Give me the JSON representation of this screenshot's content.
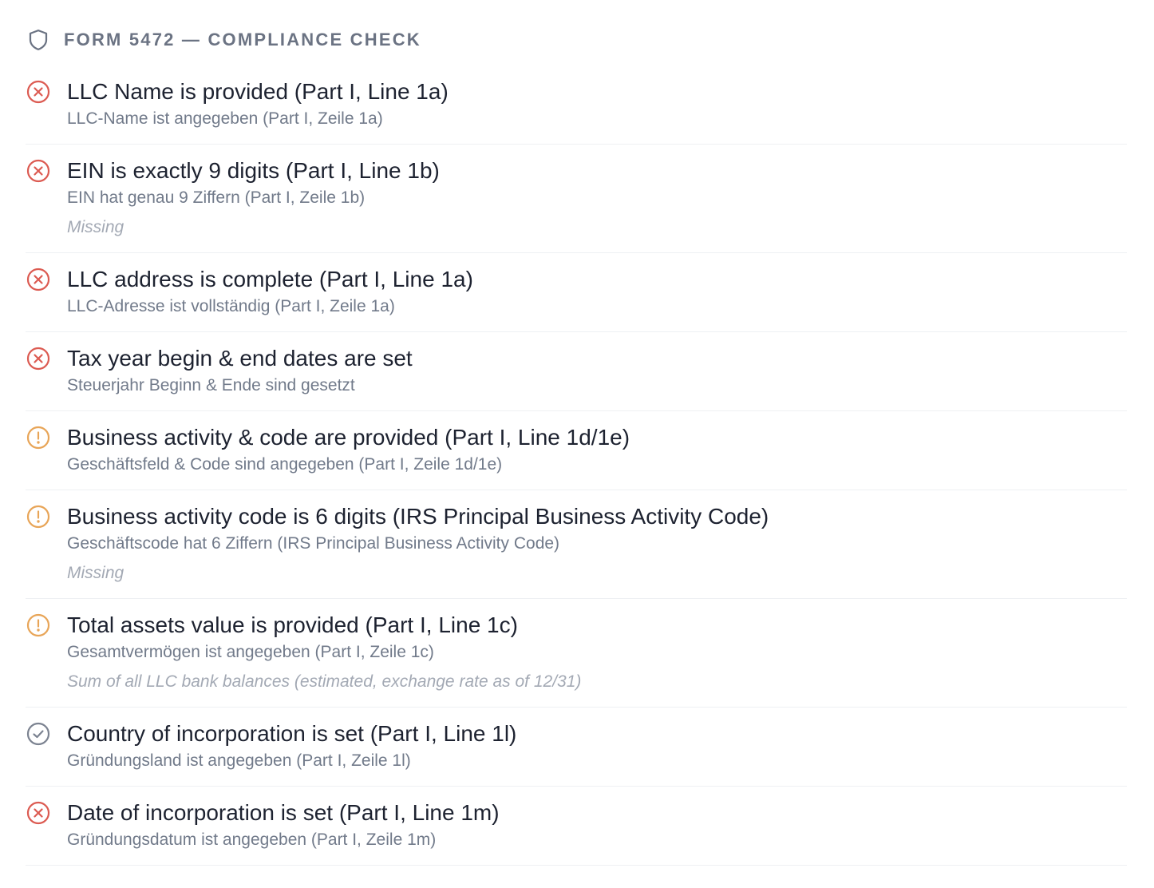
{
  "header": {
    "title": "FORM 5472 — COMPLIANCE CHECK",
    "icon": "shield-icon"
  },
  "colors": {
    "error": "#dc5b52",
    "warning": "#e8a558",
    "ok": "#7c8391"
  },
  "checks": [
    {
      "status": "error",
      "icon": "error-circle-icon",
      "title": "LLC Name is provided (Part I, Line 1a)",
      "subtitle": "LLC-Name ist angegeben (Part I, Zeile 1a)",
      "note": ""
    },
    {
      "status": "error",
      "icon": "error-circle-icon",
      "title": "EIN is exactly 9 digits (Part I, Line 1b)",
      "subtitle": "EIN hat genau 9 Ziffern (Part I, Zeile 1b)",
      "note": "Missing"
    },
    {
      "status": "error",
      "icon": "error-circle-icon",
      "title": "LLC address is complete (Part I, Line 1a)",
      "subtitle": "LLC-Adresse ist vollständig (Part I, Zeile 1a)",
      "note": ""
    },
    {
      "status": "error",
      "icon": "error-circle-icon",
      "title": "Tax year begin & end dates are set",
      "subtitle": "Steuerjahr Beginn & Ende sind gesetzt",
      "note": ""
    },
    {
      "status": "warning",
      "icon": "warning-circle-icon",
      "title": "Business activity & code are provided (Part I, Line 1d/1e)",
      "subtitle": "Geschäftsfeld & Code sind angegeben (Part I, Zeile 1d/1e)",
      "note": ""
    },
    {
      "status": "warning",
      "icon": "warning-circle-icon",
      "title": "Business activity code is 6 digits (IRS Principal Business Activity Code)",
      "subtitle": "Geschäftscode hat 6 Ziffern (IRS Principal Business Activity Code)",
      "note": "Missing"
    },
    {
      "status": "warning",
      "icon": "warning-circle-icon",
      "title": "Total assets value is provided (Part I, Line 1c)",
      "subtitle": "Gesamtvermögen ist angegeben (Part I, Zeile 1c)",
      "note": "Sum of all LLC bank balances (estimated, exchange rate as of 12/31)"
    },
    {
      "status": "ok",
      "icon": "check-circle-icon",
      "title": "Country of incorporation is set (Part I, Line 1l)",
      "subtitle": "Gründungsland ist angegeben (Part I, Zeile 1l)",
      "note": ""
    },
    {
      "status": "error",
      "icon": "error-circle-icon",
      "title": "Date of incorporation is set (Part I, Line 1m)",
      "subtitle": "Gründungsdatum ist angegeben (Part I, Zeile 1m)",
      "note": ""
    }
  ]
}
